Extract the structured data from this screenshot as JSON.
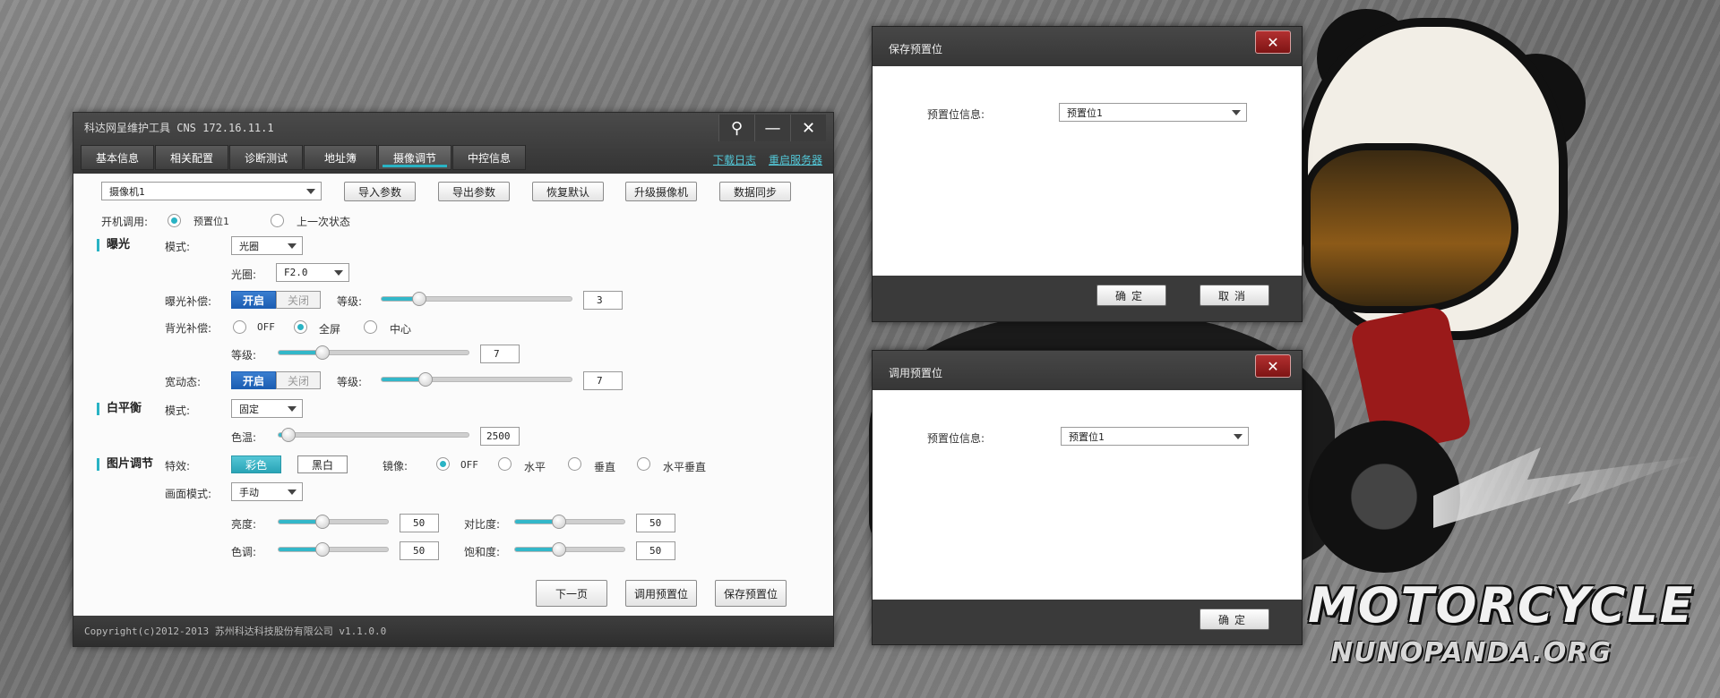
{
  "wallpaper": {
    "brand": "MOTORCYCLE",
    "brand_sub": "NUNOPANDA.ORG"
  },
  "main": {
    "title": "科达网呈维护工具  CNS 172.16.11.1",
    "controls": {
      "pin": "⚲",
      "minimize": "—",
      "close": "✕"
    },
    "tabs": [
      "基本信息",
      "相关配置",
      "诊断测试",
      "地址簿",
      "摄像调节",
      "中控信息"
    ],
    "active_tab": "摄像调节",
    "links": {
      "download_log": "下载日志",
      "restart_server": "重启服务器"
    },
    "camera_select": "摄像机1",
    "toolbar": {
      "import": "导入参数",
      "export": "导出参数",
      "restore": "恢复默认",
      "upgrade": "升级摄像机",
      "sync": "数据同步"
    },
    "boot": {
      "label": "开机调用:",
      "preset": "预置位1",
      "last_state": "上一次状态",
      "selected": "预置位1"
    },
    "exposure": {
      "title": "曝光",
      "mode_label": "模式:",
      "mode_value": "光圈",
      "aperture_label": "光圈:",
      "aperture_value": "F2.0",
      "comp_label": "曝光补偿:",
      "on": "开启",
      "off": "关闭",
      "comp_state": "开启",
      "level_label": "等级:",
      "comp_level": 3,
      "comp_level_text": "3",
      "backlight_label": "背光补偿:",
      "backlight_options": [
        "OFF",
        "全屏",
        "中心"
      ],
      "backlight_selected": "全屏",
      "backlight_level_label": "等级:",
      "backlight_level": 7,
      "backlight_level_text": "7",
      "wdr_label": "宽动态:",
      "wdr_state": "开启",
      "wdr_level_label": "等级:",
      "wdr_level": 7,
      "wdr_level_text": "7"
    },
    "white_balance": {
      "title": "白平衡",
      "mode_label": "模式:",
      "mode_value": "固定",
      "temp_label": "色温:",
      "temp_value": 2500,
      "temp_text": "2500"
    },
    "image": {
      "title": "图片调节",
      "effect_label": "特效:",
      "effect_color": "彩色",
      "effect_bw": "黑白",
      "effect_selected": "彩色",
      "mirror_label": "镜像:",
      "mirror_options": [
        "OFF",
        "水平",
        "垂直",
        "水平垂直"
      ],
      "mirror_selected": "OFF",
      "picture_mode_label": "画面模式:",
      "picture_mode_value": "手动",
      "brightness_label": "亮度:",
      "brightness": 50,
      "brightness_text": "50",
      "contrast_label": "对比度:",
      "contrast": 50,
      "contrast_text": "50",
      "hue_label": "色调:",
      "hue": 50,
      "hue_text": "50",
      "saturation_label": "饱和度:",
      "saturation": 50,
      "saturation_text": "50"
    },
    "bottom_buttons": {
      "next": "下一页",
      "call_preset": "调用预置位",
      "save_preset": "保存预置位"
    },
    "footer": "Copyright(c)2012-2013 苏州科达科技股份有限公司 v1.1.0.0"
  },
  "save_dialog": {
    "title": "保存预置位",
    "close": "✕",
    "label": "预置位信息:",
    "value": "预置位1",
    "ok": "确定",
    "cancel": "取消"
  },
  "call_dialog": {
    "title": "调用预置位",
    "close": "✕",
    "label": "预置位信息:",
    "value": "预置位1",
    "ok": "确定"
  },
  "colors": {
    "accent": "#29b3c4",
    "toggle_on": "#1c5eb3",
    "close_red": "#9a1e1e",
    "titlebar": "#3c3c3c"
  }
}
